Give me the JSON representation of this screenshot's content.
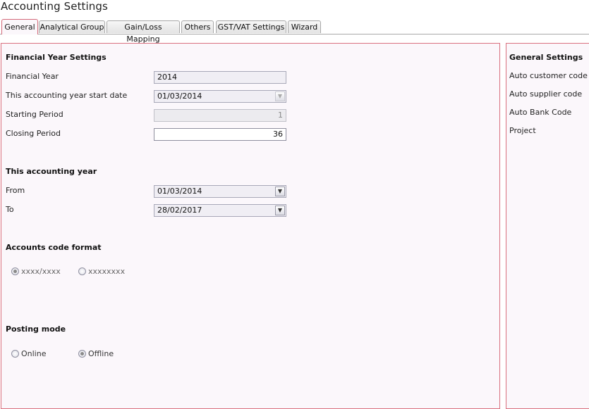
{
  "page_title": "Accounting Settings",
  "tabs": [
    {
      "label": "General",
      "active": true
    },
    {
      "label": "Analytical Group",
      "active": false
    },
    {
      "label": "Gain/Loss Mapping",
      "active": false
    },
    {
      "label": "Others",
      "active": false
    },
    {
      "label": "GST/VAT Settings",
      "active": false
    },
    {
      "label": "Wizard",
      "active": false
    }
  ],
  "financial_year_settings": {
    "title": "Financial Year Settings",
    "financial_year": {
      "label": "Financial Year",
      "value": "2014"
    },
    "start_date": {
      "label": "This accounting year start date",
      "value": "01/03/2014"
    },
    "starting_period": {
      "label": "Starting Period",
      "value": "1"
    },
    "closing_period": {
      "label": "Closing Period",
      "value": "36"
    }
  },
  "this_accounting_year": {
    "title": "This accounting year",
    "from": {
      "label": "From",
      "value": "01/03/2014"
    },
    "to": {
      "label": "To",
      "value": "28/02/2017"
    }
  },
  "accounts_code_format": {
    "title": "Accounts code format",
    "options": [
      {
        "label": "xxxx/xxxx",
        "selected": true
      },
      {
        "label": "xxxxxxxx",
        "selected": false
      }
    ]
  },
  "posting_mode": {
    "title": "Posting mode",
    "options": [
      {
        "label": "Online",
        "selected": false
      },
      {
        "label": "Offline",
        "selected": true
      }
    ]
  },
  "general_settings": {
    "title": "General Settings",
    "items": [
      "Auto customer code",
      "Auto supplier code",
      "Auto Bank Code",
      "Project"
    ]
  },
  "icons": {
    "dropdown": "chevron-down-icon"
  },
  "colors": {
    "panel_border": "#d9707e",
    "panel_bg": "#fbf7fb"
  }
}
